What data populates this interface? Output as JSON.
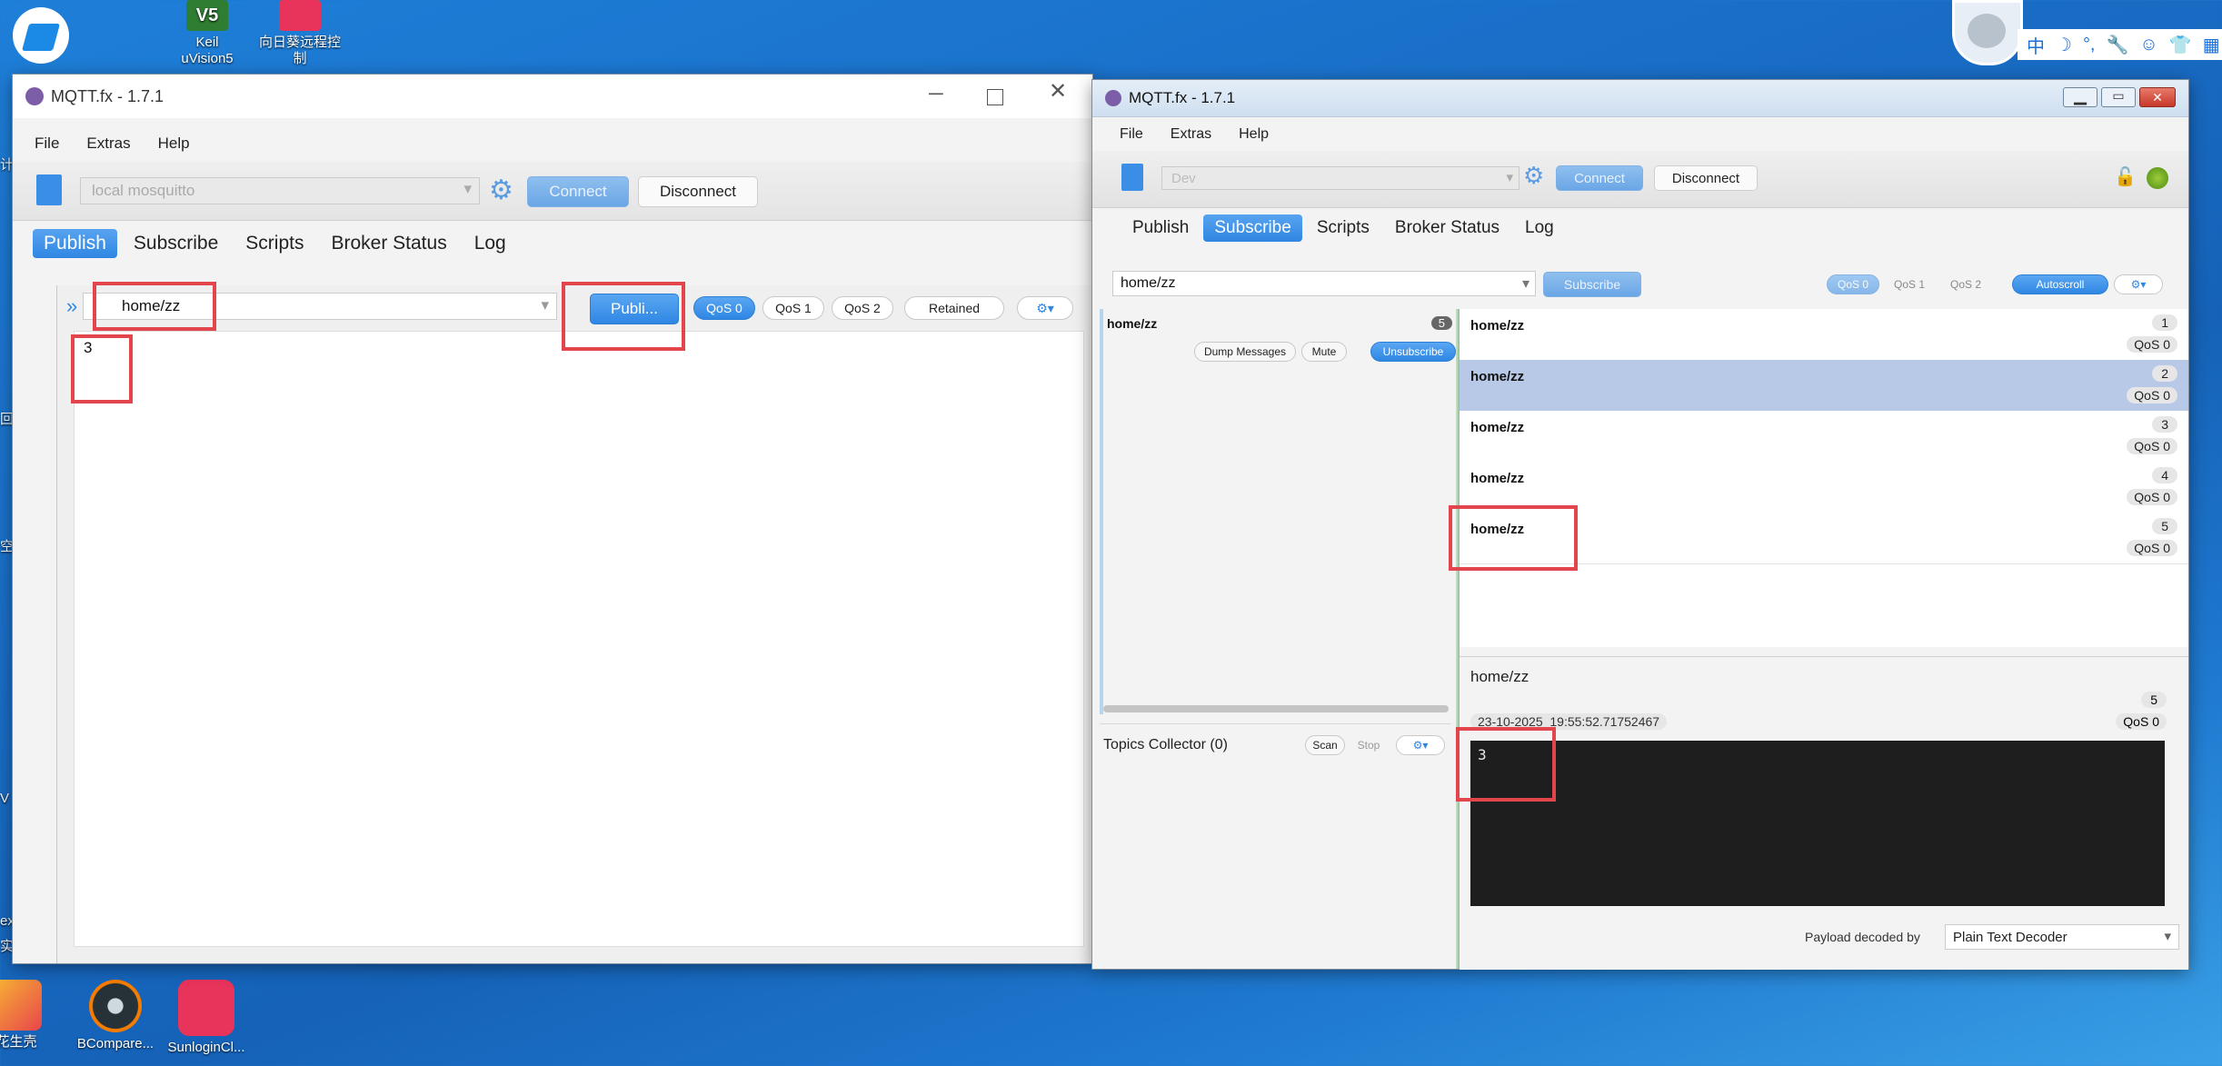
{
  "desktop": {
    "icons_top": [
      {
        "label": "Keil uVision5",
        "line1": "Keil",
        "line2": "uVision5"
      },
      {
        "label": "向日葵远程控制",
        "line1": "向日葵远程控",
        "line2": "制"
      }
    ],
    "icons_bottom": [
      {
        "label": "花生壳"
      },
      {
        "label": "BCompare..."
      },
      {
        "label": "SunloginCl..."
      }
    ],
    "left_edge_fragments": [
      "计",
      "回",
      "空",
      "V",
      "ex",
      "实"
    ],
    "ime_toolbar": {
      "lang": "中",
      "moon": "☽",
      "punct": "°,",
      "wrench": "🔧",
      "smile": "☺",
      "shirt": "👕",
      "grid": "▦"
    }
  },
  "left_window": {
    "title": "MQTT.fx - 1.7.1",
    "menu": [
      "File",
      "Extras",
      "Help"
    ],
    "profile_placeholder": "local mosquitto",
    "connect_label": "Connect",
    "disconnect_label": "Disconnect",
    "tabs": [
      "Publish",
      "Subscribe",
      "Scripts",
      "Broker Status",
      "Log"
    ],
    "active_tab": "Publish",
    "topic_value": "home/zz",
    "publish_label": "Publi...",
    "qos_options": [
      "QoS 0",
      "QoS 1",
      "QoS 2"
    ],
    "qos_selected": "QoS 0",
    "retained_label": "Retained",
    "payload": "3",
    "expand_glyph": "»"
  },
  "right_window": {
    "title": "MQTT.fx - 1.7.1",
    "menu": [
      "File",
      "Extras",
      "Help"
    ],
    "profile_placeholder": "Dev",
    "connect_label": "Connect",
    "disconnect_label": "Disconnect",
    "tabs": [
      "Publish",
      "Subscribe",
      "Scripts",
      "Broker Status",
      "Log"
    ],
    "active_tab": "Subscribe",
    "subscribe_topic": "home/zz",
    "subscribe_label": "Subscribe",
    "qos_options": [
      "QoS 0",
      "QoS 1",
      "QoS 2"
    ],
    "autoscroll_label": "Autoscroll",
    "subscription": {
      "topic": "home/zz",
      "count": "5",
      "dump_label": "Dump Messages",
      "mute_label": "Mute",
      "unsubscribe_label": "Unsubscribe"
    },
    "messages": [
      {
        "topic": "home/zz",
        "num": "1",
        "qos": "QoS 0"
      },
      {
        "topic": "home/zz",
        "num": "2",
        "qos": "QoS 0"
      },
      {
        "topic": "home/zz",
        "num": "3",
        "qos": "QoS 0"
      },
      {
        "topic": "home/zz",
        "num": "4",
        "qos": "QoS 0"
      },
      {
        "topic": "home/zz",
        "num": "5",
        "qos": "QoS 0"
      }
    ],
    "selected_message_index": 1,
    "topics_collector": {
      "label": "Topics Collector (0)",
      "scan_label": "Scan",
      "stop_label": "Stop"
    },
    "detail": {
      "topic": "home/zz",
      "num": "5",
      "timestamp": "23-10-2025  19:55:52.71752467",
      "qos": "QoS 0",
      "payload": "3"
    },
    "decoder_label": "Payload decoded by",
    "decoder_value": "Plain Text Decoder"
  }
}
